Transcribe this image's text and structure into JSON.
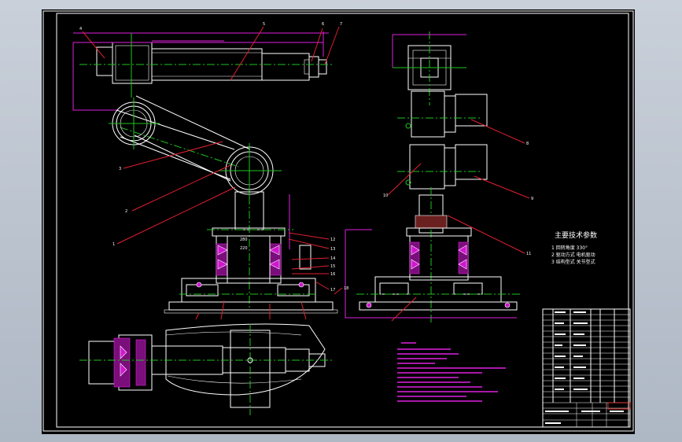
{
  "notes": {
    "heading": "主要技术参数",
    "items": [
      "1  回转角度   330°",
      "2  驱动方式   电机驱动",
      "3  结构型式   关节型式"
    ]
  },
  "colors": {
    "background": "#000000",
    "outer_frame": "#ffffff",
    "centerline": "#1ec41e",
    "dimension": "#e020e0",
    "leader": "#e02030",
    "requirements_text": "#ff40ff"
  },
  "balloons": {
    "front_top": [
      "4",
      "5",
      "6",
      "7"
    ],
    "front_left": [
      "3",
      "2",
      "1"
    ],
    "front_base": [
      "12",
      "13",
      "14",
      "15",
      "16",
      "17",
      "18"
    ],
    "side": [
      "8",
      "9",
      "10",
      "11"
    ]
  }
}
